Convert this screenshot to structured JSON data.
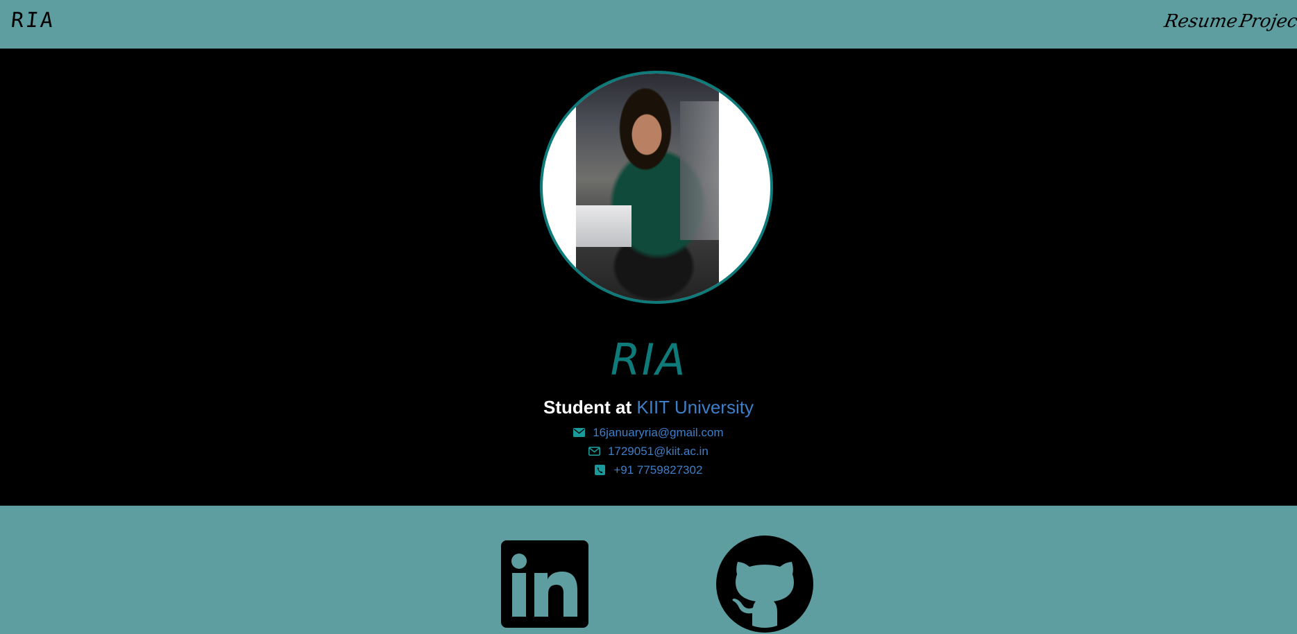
{
  "header": {
    "brand": "RIA",
    "nav": [
      {
        "label": "Resume"
      },
      {
        "label": "Projects"
      }
    ]
  },
  "profile": {
    "name": "RIA",
    "subtitle_prefix": "Student at",
    "university": "KIIT University",
    "contacts": [
      {
        "icon": "envelope-icon",
        "text": "16januaryria@gmail.com"
      },
      {
        "icon": "envelope-outline-icon",
        "text": "1729051@kiit.ac.in"
      },
      {
        "icon": "phone-icon",
        "text": "+91 7759827302"
      }
    ]
  },
  "footer": {
    "social": [
      {
        "icon": "linkedin-icon"
      },
      {
        "icon": "github-icon"
      }
    ]
  },
  "colors": {
    "header_bg": "#5f9ea0",
    "accent": "#0e7a7a",
    "link": "#3d7fc9",
    "page_bg": "#000000"
  }
}
